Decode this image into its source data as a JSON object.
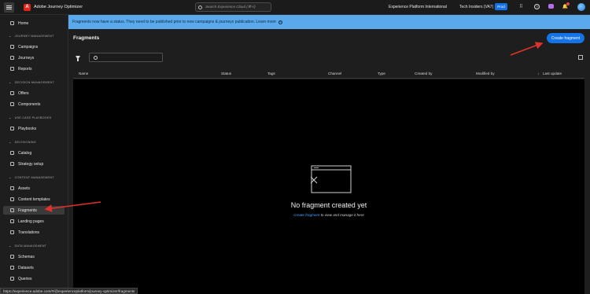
{
  "topbar": {
    "app_name": "Adobe Journey Optimizer",
    "logo_letter": "A",
    "search_placeholder": "Search Experience Cloud (⌘+/)",
    "org_name": "Experience Platform International",
    "sandbox_name": "Tech Insiders (VA7)",
    "env_badge": "Prod",
    "notification_count": "8"
  },
  "sidebar": {
    "home": "Home",
    "sections": [
      {
        "label": "JOURNEY MANAGEMENT",
        "items": [
          "Campaigns",
          "Journeys",
          "Reports"
        ]
      },
      {
        "label": "DECISION MANAGEMENT",
        "items": [
          "Offers",
          "Components"
        ]
      },
      {
        "label": "USE CASE PLAYBOOKS",
        "items": [
          "Playbooks"
        ]
      },
      {
        "label": "DECISIONING",
        "items": [
          "Catalog",
          "Strategy setup"
        ]
      },
      {
        "label": "CONTENT MANAGEMENT",
        "items": [
          "Assets",
          "Content templates",
          "Fragments",
          "Landing pages",
          "Translations"
        ]
      },
      {
        "label": "DATA MANAGEMENT",
        "items": [
          "Schemas",
          "Datasets",
          "Queries"
        ]
      }
    ],
    "active_item": "Fragments"
  },
  "banner": {
    "text": "Fragments now have a status. They need to be published prior to new campaigns & journeys publication. Learn more"
  },
  "main": {
    "title": "Fragments",
    "create_button": "Create fragment",
    "search_value": "",
    "columns": [
      "Name",
      "Status",
      "Tags",
      "Channel",
      "Type",
      "Created by",
      "Modified by",
      "Last update"
    ],
    "sort_indicator": "↓",
    "empty_title": "No fragment created yet",
    "empty_link": "Create fragment",
    "empty_suffix": " to view and manage it here"
  },
  "statusbar": {
    "url": "https://experience.adobe.com/#/@experienceplatform/journey-optimizer/fragments"
  },
  "colors": {
    "accent": "#1473e6",
    "banner": "#5aa9ec",
    "annotation_arrow": "#e0322b"
  }
}
